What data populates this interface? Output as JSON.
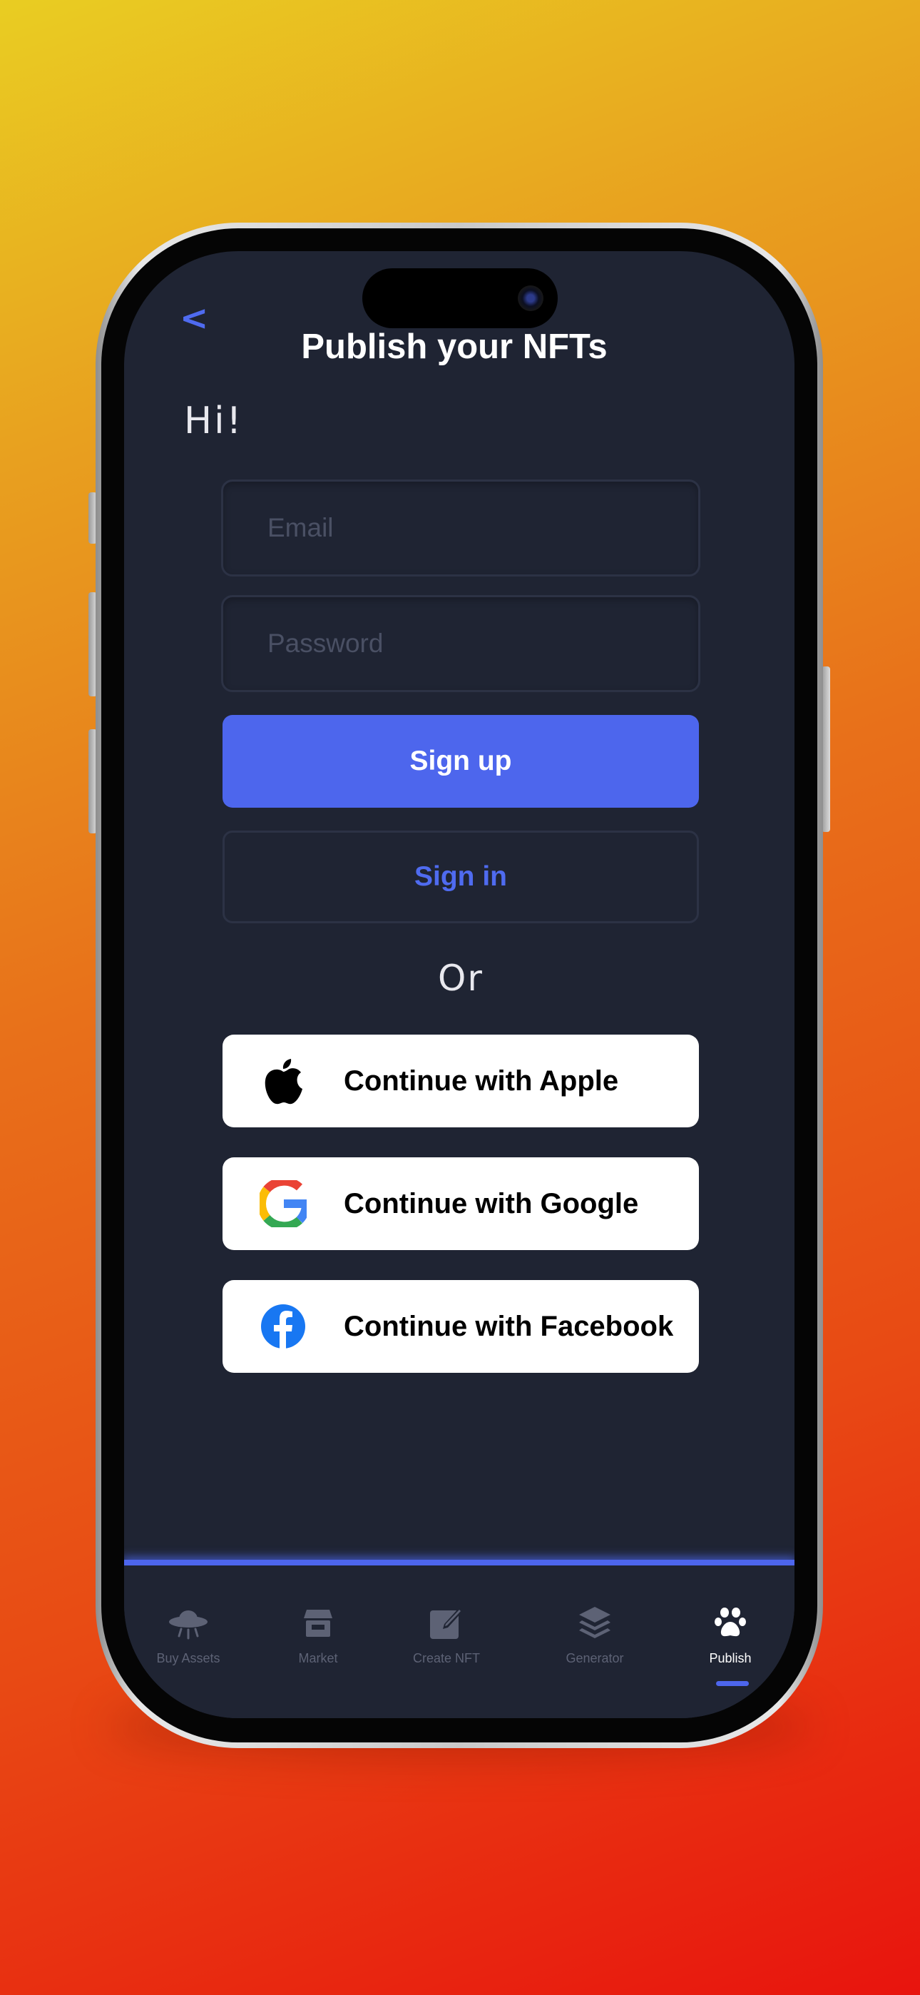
{
  "header": {
    "back_label": "<",
    "title": "Publish your NFTs"
  },
  "greeting": "Hi!",
  "form": {
    "email_placeholder": "Email",
    "password_placeholder": "Password",
    "signup_label": "Sign up",
    "signin_label": "Sign in",
    "or_label": "Or"
  },
  "social": {
    "apple_label": "Continue with Apple",
    "google_label": "Continue with Google",
    "facebook_label": "Continue with Facebook"
  },
  "tabs": [
    {
      "label": "Buy Assets",
      "icon": "ufo-icon"
    },
    {
      "label": "Market",
      "icon": "store-icon"
    },
    {
      "label": "Create NFT",
      "icon": "edit-icon"
    },
    {
      "label": "Generator",
      "icon": "layers-icon"
    },
    {
      "label": "Publish",
      "icon": "paw-icon",
      "active": true
    }
  ],
  "colors": {
    "accent": "#4d66ed",
    "background": "#1f2433",
    "inactive": "#5d6275"
  }
}
